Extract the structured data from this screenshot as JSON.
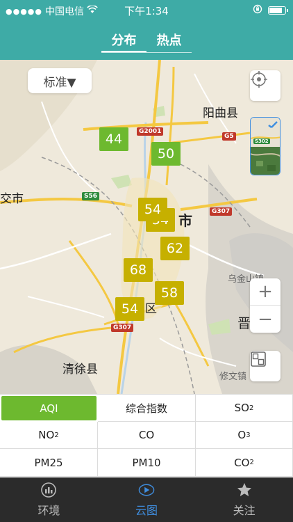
{
  "status_bar": {
    "signal": "●●●●●",
    "carrier": "中国电信",
    "time": "下午1:34"
  },
  "segment_tabs": [
    {
      "label": "分布",
      "active": true
    },
    {
      "label": "热点",
      "active": false
    }
  ],
  "map": {
    "standard_button": "标准▼",
    "place_labels": {
      "yangqu": "阳曲县",
      "jiaocheng": "交市",
      "city": "市",
      "qingxu": "清徐县",
      "district": "区",
      "jin": "晋",
      "wujin": "乌金山镇",
      "xiuwen": "修文镇"
    },
    "road_signs": {
      "g2001": "G2001",
      "g5": "G5",
      "s56": "S56",
      "g307_east": "G307",
      "g307_south": "G307",
      "s302": "S302"
    },
    "markers": [
      {
        "value": "44",
        "level": "green"
      },
      {
        "value": "50",
        "level": "green"
      },
      {
        "value": "54",
        "level": "yellow"
      },
      {
        "value": "54",
        "level": "yellow"
      },
      {
        "value": "62",
        "level": "yellow"
      },
      {
        "value": "68",
        "level": "yellow"
      },
      {
        "value": "58",
        "level": "yellow"
      },
      {
        "value": "54",
        "level": "yellow"
      }
    ],
    "zoom_in": "+",
    "zoom_out": "−"
  },
  "pollutants": {
    "aqi": "AQI",
    "composite": "综合指数",
    "so2": "SO",
    "so2_sub": "2",
    "no2": "NO",
    "no2_sub": "2",
    "co": "CO",
    "o3": "O",
    "o3_sub": "3",
    "pm25": "PM25",
    "pm10": "PM10",
    "co2": "CO",
    "co2_sub": "2"
  },
  "tabbar": {
    "env": "环境",
    "cloud": "云图",
    "follow": "关注"
  },
  "colors": {
    "header": "#3eaba6",
    "good": "#6db92f",
    "moderate": "#c6b000",
    "tab_active": "#3f8ee0"
  }
}
